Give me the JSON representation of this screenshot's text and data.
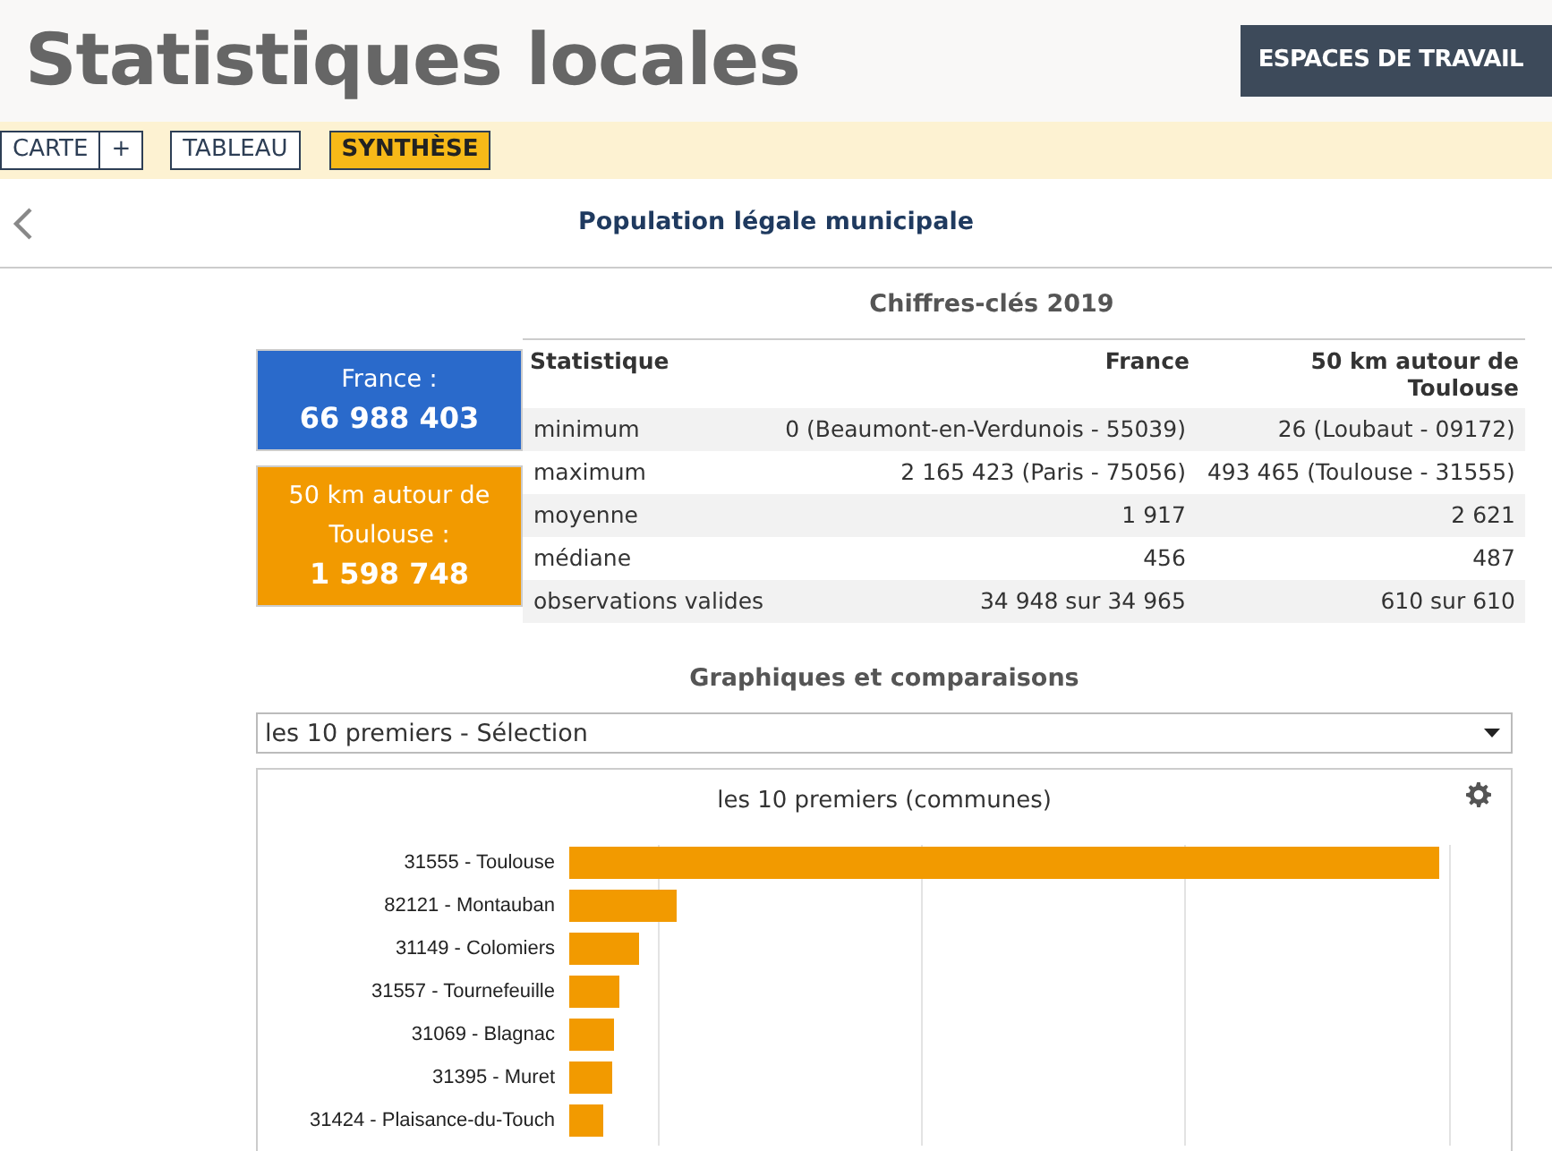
{
  "header": {
    "title": "Statistiques locales",
    "workspace_button": "ESPACES DE TRAVAIL"
  },
  "tabs": [
    {
      "label": "CARTE",
      "selected": false
    },
    {
      "label": "+",
      "selected": false
    },
    {
      "label": "TABLEAU",
      "selected": false
    },
    {
      "label": "SYNTHÈSE",
      "selected": true
    }
  ],
  "page_title": "Population légale municipale",
  "key_figures": {
    "title": "Chiffres-clés 2019",
    "summary_boxes": [
      {
        "label": "France :",
        "value": "66 988 403",
        "color": "#2a6acb"
      },
      {
        "label": "50 km autour de Toulouse :",
        "value": "1 598 748",
        "color": "#f29a00"
      }
    ],
    "table": {
      "columns": [
        "Statistique",
        "France",
        "50 km autour de Toulouse"
      ],
      "rows": [
        [
          "minimum",
          "0 (Beaumont-en-Verdunois - 55039)",
          "26 (Loubaut - 09172)"
        ],
        [
          "maximum",
          "2 165 423 (Paris - 75056)",
          "493 465 (Toulouse - 31555)"
        ],
        [
          "moyenne",
          "1 917",
          "2 621"
        ],
        [
          "médiane",
          "456",
          "487"
        ],
        [
          "observations valides",
          "34 948 sur 34 965",
          "610 sur 610"
        ]
      ]
    }
  },
  "charts_section": {
    "title": "Graphiques et comparaisons",
    "select": "les 10 premiers - Sélection",
    "chart": {
      "title": "les 10 premiers (communes)",
      "bars": [
        {
          "label": "31555 - Toulouse"
        },
        {
          "label": "82121 - Montauban"
        },
        {
          "label": "31149 - Colomiers"
        },
        {
          "label": "31557 - Tournefeuille"
        },
        {
          "label": "31069 - Blagnac"
        },
        {
          "label": "31395 - Muret"
        },
        {
          "label": "31424 - Plaisance-du-Touch"
        }
      ]
    }
  }
}
